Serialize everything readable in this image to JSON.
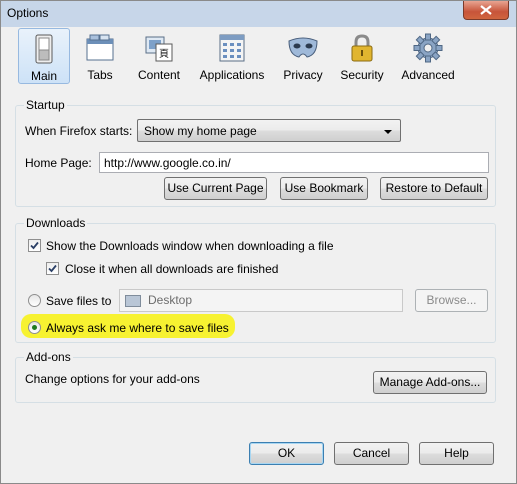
{
  "window": {
    "title": "Options"
  },
  "colors": {
    "title_bar": "#c7d6e9",
    "highlight": "#f7f21c",
    "selected_tab": "#cde2f7"
  },
  "tabs": [
    {
      "label": "Main",
      "icon": "switch-icon",
      "selected": true
    },
    {
      "label": "Tabs",
      "icon": "tabs-window-icon"
    },
    {
      "label": "Content",
      "icon": "content-icon"
    },
    {
      "label": "Applications",
      "icon": "applications-icon"
    },
    {
      "label": "Privacy",
      "icon": "mask-icon"
    },
    {
      "label": "Security",
      "icon": "padlock-icon"
    },
    {
      "label": "Advanced",
      "icon": "gear-icon"
    }
  ],
  "startup": {
    "title": "Startup",
    "when_starts_label": "When Firefox starts:",
    "when_starts_value": "Show my home page",
    "home_page_label": "Home Page:",
    "home_page_value": "http://www.google.co.in/",
    "use_current_page": "Use Current Page",
    "use_bookmark": "Use Bookmark",
    "restore_default": "Restore to Default"
  },
  "downloads": {
    "title": "Downloads",
    "show_window_label": "Show the Downloads window when downloading a file",
    "show_window_checked": true,
    "close_when_done_label": "Close it when all downloads are finished",
    "close_when_done_checked": true,
    "save_files_to_label": "Save files to",
    "save_folder": "Desktop",
    "browse": "Browse...",
    "always_ask_label": "Always ask me where to save files",
    "always_ask_selected": true
  },
  "addons": {
    "title": "Add-ons",
    "description": "Change options for your add-ons",
    "manage": "Manage Add-ons..."
  },
  "footer": {
    "ok": "OK",
    "cancel": "Cancel",
    "help": "Help"
  }
}
